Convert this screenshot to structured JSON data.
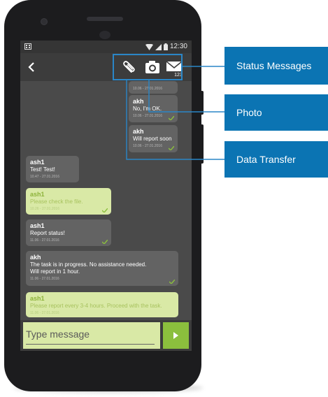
{
  "statusbar": {
    "time": "12:30"
  },
  "toolbar": {
    "back_icon": "chevron-left-icon",
    "icons": [
      "paperclip-icon",
      "camera-icon",
      "envelope-123-icon"
    ],
    "envelope_badge": "123"
  },
  "messages": [
    {
      "sender": "",
      "text": "",
      "timestamp": "10.06 - 27.01.2016",
      "style": "dark"
    },
    {
      "sender": "akh",
      "text": "No, I'm OK.",
      "timestamp": "10.06 - 27.01.2016",
      "style": "dark"
    },
    {
      "sender": "akh",
      "text": "Will report soon",
      "timestamp": "10.06 - 27.01.2016",
      "style": "dark"
    },
    {
      "sender": "ash1",
      "text": "Test! Test!",
      "timestamp": "10.47 - 27.01.2016",
      "style": "dark"
    },
    {
      "sender": "ash1",
      "text": "Please check the file.",
      "timestamp": "10.26 - 27.01.2016",
      "style": "light"
    },
    {
      "sender": "ash1",
      "text": "Report status!",
      "timestamp": "11.06 - 27.01.2016",
      "style": "dark"
    },
    {
      "sender": "akh",
      "text": "The task is in progress. No assistance needed.",
      "text2": "Will report in 1 hour.",
      "timestamp": "11.06 - 27.01.2016",
      "style": "dark"
    },
    {
      "sender": "ash1",
      "text": "Please report every 3-4 hours. Proceed with the task.",
      "timestamp": "11.06 - 27.01.2016",
      "style": "light"
    }
  ],
  "composer": {
    "placeholder": "Type message",
    "send_icon": "send-arrow-icon"
  },
  "callouts": {
    "status": "Status Messages",
    "photo": "Photo",
    "data": "Data Transfer"
  },
  "colors": {
    "accent": "#0b74b3",
    "highlight": "#2a86c7",
    "bubble_light": "#d9e9a6",
    "send": "#8bbf3d"
  }
}
